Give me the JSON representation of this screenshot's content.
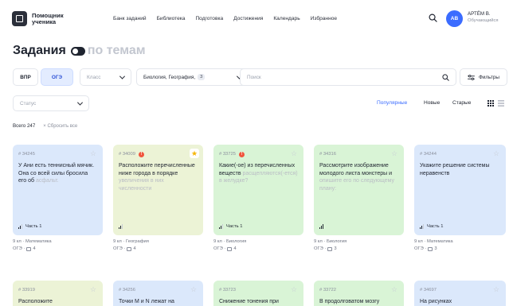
{
  "header": {
    "logo": "Помощник ученика",
    "nav": [
      "Банк заданий",
      "Библиотека",
      "Подготовка",
      "Достижения",
      "Календарь",
      "Избранное"
    ],
    "user": {
      "initials": "АВ",
      "name": "АРТЁМ В.",
      "role": "Обучающийся"
    }
  },
  "page": {
    "title": "Задания",
    "topic_toggle": "по темам"
  },
  "filters": {
    "exam_vpr": "ВПР",
    "exam_oge": "ОГЭ",
    "class_placeholder": "Класс",
    "subjects_value": "Биология, География,",
    "subjects_count": "3",
    "search_placeholder": "Поиск",
    "filters_label": "Фильтры",
    "status_placeholder": "Статус"
  },
  "sort": {
    "popular": "Популярные",
    "new": "Новые",
    "old": "Старые"
  },
  "summary": {
    "total": "Всего 247",
    "reset": "Сбросить все"
  },
  "cards": [
    {
      "id": "# 34245",
      "text": "У Ани есть теннисный мячик. Она со всей силы бросила его об",
      "fade": "асфальт.",
      "part": "Часть 1",
      "meta1": "9 кл · Математика",
      "exam": "ОГЭ ·",
      "comments": "4"
    },
    {
      "id": "# 34009",
      "text": "Расположите перечисленные ниже города в порядке",
      "fade": "увеличения в них численности",
      "part": "",
      "meta1": "9 кл · География",
      "exam": "ОГЭ ·",
      "comments": "4"
    },
    {
      "id": "# 33725",
      "text": "Какие(-ое) из перечисленных веществ",
      "fade": "расщепляются(-ется) в желудке?",
      "part": "Часть 1",
      "meta1": "9 кл · Биология",
      "exam": "ОГЭ ·",
      "comments": "4"
    },
    {
      "id": "# 34316",
      "text": "Рассмотрите изображение молодого листа монстеры и",
      "fade": "опишите его по следующему плану:",
      "part": "",
      "meta1": "9 кл · Биология",
      "exam": "ОГЭ ·",
      "comments": "3"
    },
    {
      "id": "# 34244",
      "text": "Укажите решение системы неравенств",
      "fade": "",
      "part": "Часть 1",
      "meta1": "9 кл · Математика",
      "exam": "ОГЭ ·",
      "comments": "3"
    },
    {
      "id": "# 33919",
      "text": "Расположите",
      "fade": ""
    },
    {
      "id": "# 34256",
      "text": "Точки M и N лежат на",
      "fade": ""
    },
    {
      "id": "# 33723",
      "text": "Снижение тонения при",
      "fade": ""
    },
    {
      "id": "# 33722",
      "text": "В продолговатом мозгу",
      "fade": ""
    },
    {
      "id": "# 34697",
      "text": "На рисунках",
      "fade": ""
    }
  ],
  "colors": {
    "accent": "#3b6cff",
    "blue_card": "#dbe8fb",
    "yellow_card": "#ecf3d6",
    "green_card": "#d9f4d6",
    "alert": "#f0553d",
    "star": "#f5b400"
  }
}
